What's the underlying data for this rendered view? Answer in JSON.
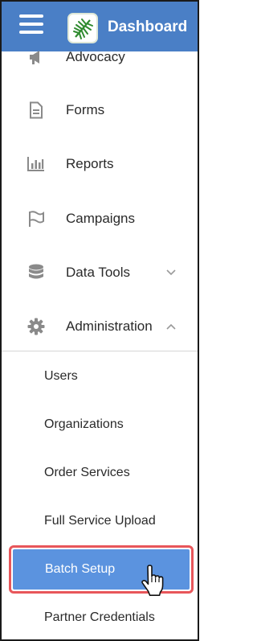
{
  "header": {
    "title": "Dashboard",
    "color": "#4a7fc6"
  },
  "nav": {
    "items": [
      {
        "label": "Advocacy",
        "icon": "megaphone-icon"
      },
      {
        "label": "Forms",
        "icon": "document-icon"
      },
      {
        "label": "Reports",
        "icon": "bar-chart-icon"
      },
      {
        "label": "Campaigns",
        "icon": "flag-icon"
      },
      {
        "label": "Data Tools",
        "icon": "database-icon",
        "expanded": false
      },
      {
        "label": "Administration",
        "icon": "gear-icon",
        "expanded": true
      }
    ]
  },
  "admin_submenu": {
    "items": [
      {
        "label": "Users"
      },
      {
        "label": "Organizations"
      },
      {
        "label": "Order Services"
      },
      {
        "label": "Full Service Upload"
      },
      {
        "label": "Batch Setup",
        "active": true
      },
      {
        "label": "Partner Credentials"
      }
    ]
  },
  "colors": {
    "active_bg": "#5b93df",
    "highlight_border": "#e8565a",
    "icon": "#8a8a8a"
  }
}
